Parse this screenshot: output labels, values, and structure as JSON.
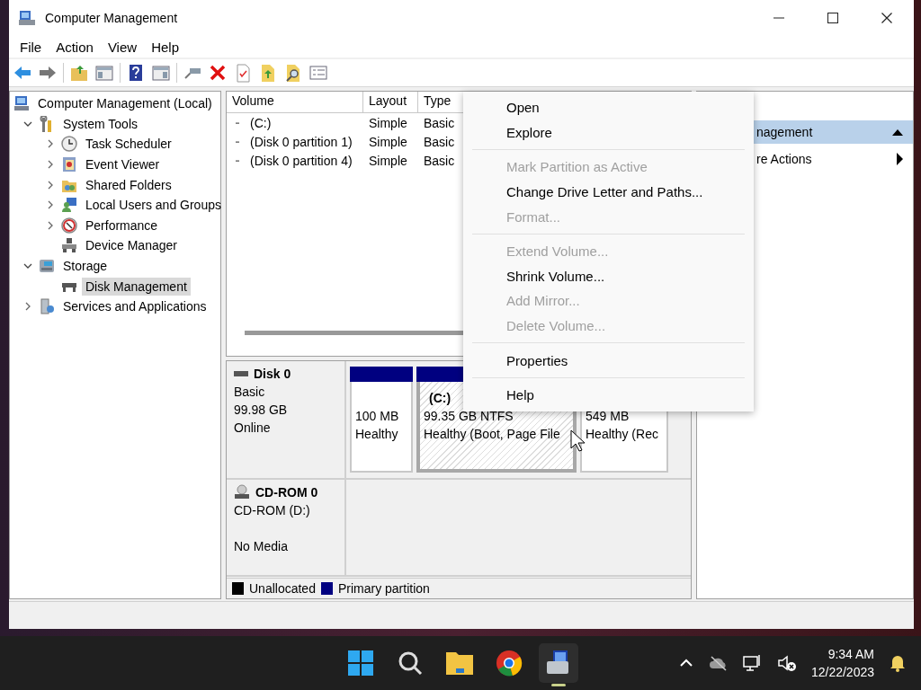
{
  "window": {
    "title": "Computer Management"
  },
  "menu_bar": [
    "File",
    "Action",
    "View",
    "Help"
  ],
  "tree": {
    "items": [
      {
        "label": "Computer Management (Local)",
        "kind": "computer",
        "selected": false,
        "children": [
          {
            "label": "System Tools",
            "kind": "tools",
            "expanded": true,
            "selected": false,
            "children": [
              {
                "label": "Task Scheduler",
                "kind": "clock",
                "expanded": false,
                "selected": false
              },
              {
                "label": "Event Viewer",
                "kind": "log",
                "expanded": false,
                "selected": false
              },
              {
                "label": "Shared Folders",
                "kind": "folder",
                "expanded": false,
                "selected": false
              },
              {
                "label": "Local Users and Groups",
                "kind": "users",
                "expanded": false,
                "selected": false
              },
              {
                "label": "Performance",
                "kind": "gauge",
                "expanded": false,
                "selected": false
              },
              {
                "label": "Device Manager",
                "kind": "device",
                "selected": false
              }
            ]
          },
          {
            "label": "Storage",
            "kind": "storage",
            "expanded": true,
            "selected": false,
            "children": [
              {
                "label": "Disk Management",
                "kind": "disk",
                "selected": true
              }
            ]
          },
          {
            "label": "Services and Applications",
            "kind": "services",
            "expanded": false,
            "selected": false
          }
        ]
      }
    ]
  },
  "volume_table": {
    "columns": [
      "Volume",
      "Layout",
      "Type"
    ],
    "rows": [
      {
        "cells": [
          "(C:)",
          "Simple",
          "Basic"
        ]
      },
      {
        "cells": [
          "(Disk 0 partition 1)",
          "Simple",
          "Basic"
        ]
      },
      {
        "cells": [
          "(Disk 0 partition 4)",
          "Simple",
          "Basic"
        ]
      }
    ]
  },
  "disks": [
    {
      "kind": "disk",
      "name": "Disk 0",
      "lines": [
        "Basic",
        "99.98 GB",
        "Online"
      ],
      "partitions": [
        {
          "size": "100 MB",
          "status": "Healthy",
          "selected": false
        },
        {
          "label": "(C:)",
          "size": "99.35 GB NTFS",
          "status": "Healthy (Boot, Page File",
          "selected": true
        },
        {
          "size": "549 MB",
          "status": "Healthy (Rec",
          "selected": false
        }
      ]
    },
    {
      "kind": "cdrom",
      "name": "CD-ROM 0",
      "lines": [
        "CD-ROM (D:)",
        "No Media"
      ]
    }
  ],
  "legend": [
    {
      "label": "Unallocated",
      "color": "#000000"
    },
    {
      "label": "Primary partition",
      "color": "#000080"
    }
  ],
  "actions": [
    {
      "kind": "header",
      "label": "nagement"
    },
    {
      "kind": "submenu",
      "label": "re Actions"
    }
  ],
  "context_menu": [
    {
      "kind": "item",
      "label": "Open",
      "disabled": false
    },
    {
      "kind": "item",
      "label": "Explore",
      "disabled": false
    },
    {
      "kind": "separator"
    },
    {
      "kind": "item",
      "label": "Mark Partition as Active",
      "disabled": true
    },
    {
      "kind": "item",
      "label": "Change Drive Letter and Paths...",
      "disabled": false
    },
    {
      "kind": "item",
      "label": "Format...",
      "disabled": true
    },
    {
      "kind": "separator"
    },
    {
      "kind": "item",
      "label": "Extend Volume...",
      "disabled": true
    },
    {
      "kind": "item",
      "label": "Shrink Volume...",
      "disabled": false
    },
    {
      "kind": "item",
      "label": "Add Mirror...",
      "disabled": true
    },
    {
      "kind": "item",
      "label": "Delete Volume...",
      "disabled": true
    },
    {
      "kind": "separator"
    },
    {
      "kind": "item",
      "label": "Properties",
      "disabled": false
    },
    {
      "kind": "separator"
    },
    {
      "kind": "item",
      "label": "Help",
      "disabled": false
    }
  ],
  "taskbar": {
    "apps": [
      {
        "kind": "start",
        "selected": false
      },
      {
        "kind": "search",
        "selected": false
      },
      {
        "kind": "files",
        "selected": false
      },
      {
        "kind": "browser",
        "selected": false
      },
      {
        "kind": "manager",
        "selected": true
      }
    ],
    "clock": {
      "time": "9:34 AM",
      "date": "12/22/2023"
    }
  }
}
